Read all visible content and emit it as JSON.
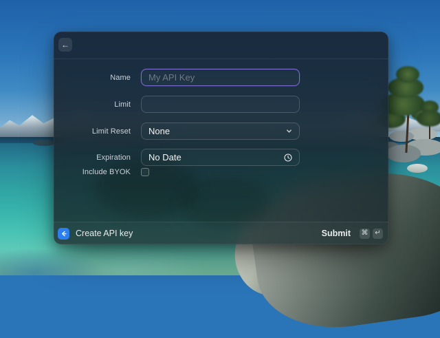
{
  "window": {
    "header": {
      "back_glyph": "←"
    },
    "form": {
      "name": {
        "label": "Name",
        "placeholder": "My API Key",
        "value": ""
      },
      "limit": {
        "label": "Limit",
        "placeholder": "",
        "value": ""
      },
      "limit_reset": {
        "label": "Limit Reset",
        "value": "None"
      },
      "expiration": {
        "label": "Expiration",
        "value": "No Date"
      },
      "include_byok": {
        "label": "Include BYOK",
        "checked": false
      }
    },
    "footer": {
      "command_title": "Create API key",
      "submit_label": "Submit",
      "keys": [
        "⌘",
        "↵"
      ]
    }
  },
  "icons": {
    "back": "arrow-left",
    "limit_reset": "chevron-down",
    "expiration": "clock",
    "extension": "chevron-left-logo",
    "submit_modifier": "command-key",
    "submit_key": "return-key"
  },
  "colors": {
    "focus_border": "#7b6cd0",
    "extension_icon_bg": "#2d7ff0"
  }
}
